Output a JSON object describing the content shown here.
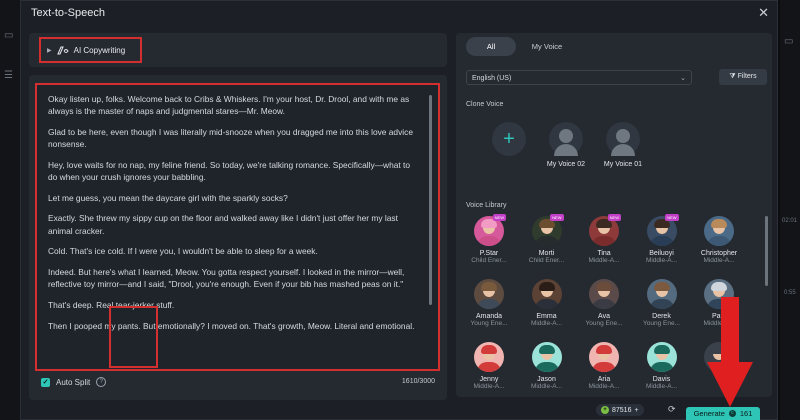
{
  "window": {
    "title": "Text-to-Speech",
    "close_icon": "✕"
  },
  "ai_copywriting": {
    "label": "AI Copywriting"
  },
  "editor": {
    "paragraphs": [
      "Okay listen up, folks. Welcome back to Cribs & Whiskers. I'm your host, Dr. Drool, and with me as always is the master of naps and judgmental stares—Mr. Meow.",
      "Glad to be here, even though I was literally mid-snooze when you dragged me into this love advice nonsense.",
      "Hey, love waits for no nap, my feline friend. So today, we're talking romance. Specifically—what to do when your crush ignores your babbling.",
      "Let me guess, you mean the daycare girl with the sparkly socks?",
      "Exactly. She threw my sippy cup on the floor and walked away like I didn't just offer her my last animal cracker.",
      "Cold. That's ice cold. If I were you, I wouldn't be able to sleep for a week.",
      "Indeed. But here's what I learned, Meow. You gotta respect yourself. I looked in the mirror—well, reflective toy mirror—and I said, \"Drool, you're enough. Even if your bib has mashed peas on it.\"",
      "That's deep. Real tear-jerker stuff.",
      "Then I pooped my pants. But emotionally? I moved on. That's growth, Meow. Literal and emotional."
    ],
    "auto_split_label": "Auto Split",
    "auto_split_checked": true,
    "char_count": "1610/3000"
  },
  "tabs": [
    {
      "label": "All",
      "active": true
    },
    {
      "label": "My Voice",
      "active": false
    }
  ],
  "language": {
    "value": "English (US)"
  },
  "filters_label": "Filters",
  "clone_voice": {
    "label": "Clone Voice",
    "items": [
      {
        "name": ""
      },
      {
        "name": "My Voice 02"
      },
      {
        "name": "My Voice 01"
      }
    ]
  },
  "voice_library": {
    "label": "Voice Library",
    "voices": [
      {
        "name": "P.Star",
        "desc": "Child Ener...",
        "new": true
      },
      {
        "name": "Morti",
        "desc": "Child Ener...",
        "new": true
      },
      {
        "name": "Tina",
        "desc": "Middle-A...",
        "new": true
      },
      {
        "name": "Beiluoyi",
        "desc": "Middle-A...",
        "new": true
      },
      {
        "name": "Christopher",
        "desc": "Middle-A...",
        "new": false
      },
      {
        "name": "Amanda",
        "desc": "Young Ene...",
        "new": false
      },
      {
        "name": "Emma",
        "desc": "Middle-A...",
        "new": false
      },
      {
        "name": "Ava",
        "desc": "Young Ene...",
        "new": false
      },
      {
        "name": "Derek",
        "desc": "Young Ene...",
        "new": false
      },
      {
        "name": "Paul",
        "desc": "Middle-A...",
        "new": false
      },
      {
        "name": "Jenny",
        "desc": "Middle-A...",
        "new": false
      },
      {
        "name": "Jason",
        "desc": "Middle-A...",
        "new": false,
        "selected": true
      },
      {
        "name": "Aria",
        "desc": "Middle-A...",
        "new": false
      },
      {
        "name": "Davis",
        "desc": "Middle-A...",
        "new": false
      },
      {
        "name": "",
        "desc": "",
        "new": false
      }
    ]
  },
  "footer": {
    "credits": "87516",
    "generate_label": "Generate",
    "generate_cost": "161"
  },
  "background": {
    "times": [
      "02:01",
      "0:55"
    ]
  },
  "colors": {
    "accent": "#2ec4b6",
    "highlight": "#d32f2f",
    "new_badge": "#c33fc7"
  }
}
